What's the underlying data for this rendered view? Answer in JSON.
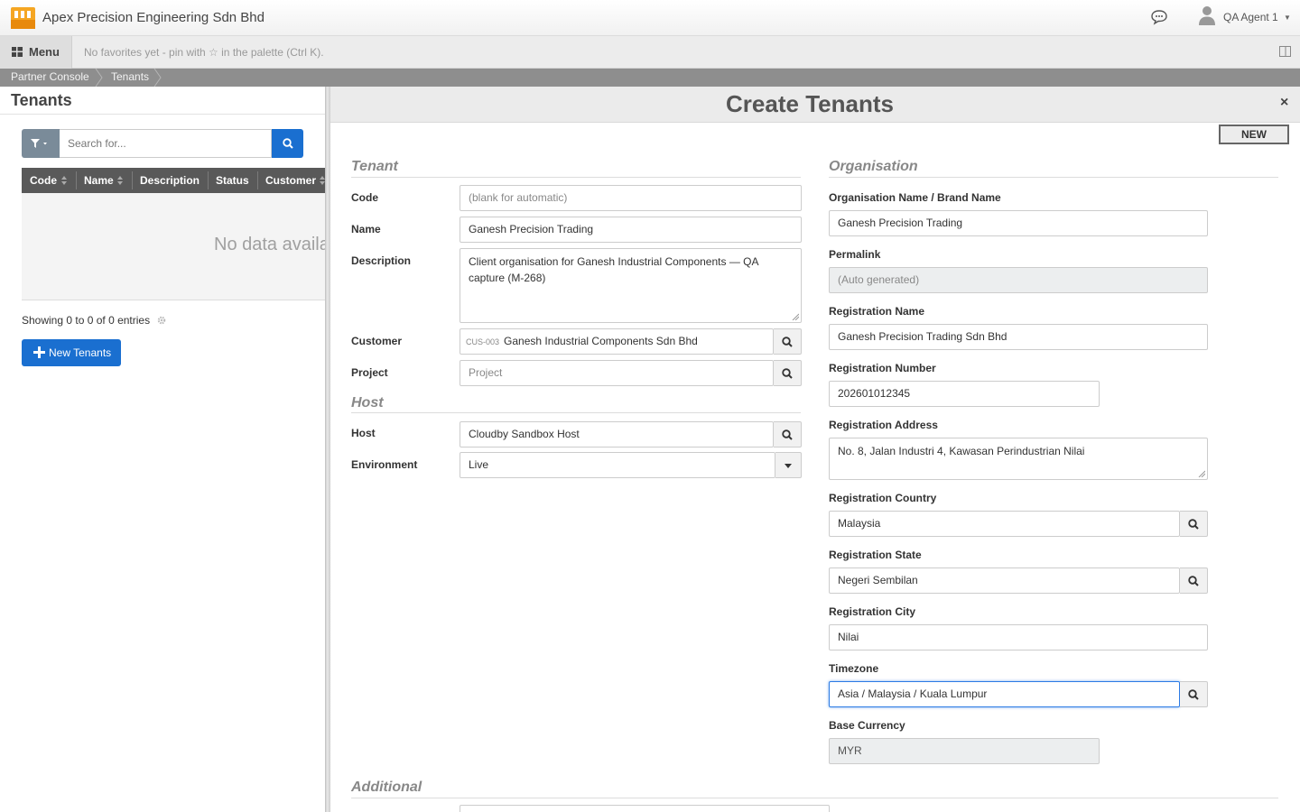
{
  "app": {
    "title": "Apex Precision Engineering Sdn Bhd",
    "user_name": "QA Agent 1",
    "accent": "#1a6fd0"
  },
  "menubar": {
    "menu_label": "Menu",
    "favorites_hint": "No favorites yet - pin with ☆ in the palette (Ctrl K)."
  },
  "breadcrumb": [
    "Partner Console",
    "Tenants"
  ],
  "list": {
    "title": "Tenants",
    "search_placeholder": "Search for...",
    "columns": [
      "Code",
      "Name",
      "Description",
      "Status",
      "Customer"
    ],
    "rows": [],
    "empty_text": "No data available in table",
    "showing": "Showing 0 to 0 of 0 entries",
    "new_button": "New Tenants"
  },
  "modal": {
    "title": "Create Tenants",
    "close": "×",
    "status_badge": "NEW",
    "sections": {
      "tenant": "Tenant",
      "organisation": "Organisation",
      "host": "Host",
      "additional": "Additional"
    },
    "tenant": {
      "code_label": "Code",
      "code_placeholder": "(blank for automatic)",
      "name_label": "Name",
      "name_value": "Ganesh Precision Trading",
      "description_label": "Description",
      "description_value": "Client organisation for Ganesh Industrial Components — QA capture (M-268)",
      "customer_label": "Customer",
      "customer_code": "CUS-003",
      "customer_value": "Ganesh Industrial Components Sdn Bhd",
      "project_label": "Project",
      "project_placeholder": "Project"
    },
    "host": {
      "host_label": "Host",
      "host_value": "Cloudby Sandbox Host",
      "environment_label": "Environment",
      "environment_value": "Live"
    },
    "organisation": {
      "org_name_label": "Organisation Name / Brand Name",
      "org_name_value": "Ganesh Precision Trading",
      "permalink_label": "Permalink",
      "permalink_placeholder": "(Auto generated)",
      "reg_name_label": "Registration Name",
      "reg_name_value": "Ganesh Precision Trading Sdn Bhd",
      "reg_number_label": "Registration Number",
      "reg_number_value": "202601012345",
      "reg_address_label": "Registration Address",
      "reg_address_value": "No. 8, Jalan Industri 4, Kawasan Perindustrian Nilai",
      "reg_country_label": "Registration Country",
      "reg_country_value": "Malaysia",
      "reg_state_label": "Registration State",
      "reg_state_value": "Negeri Sembilan",
      "reg_city_label": "Registration City",
      "reg_city_value": "Nilai",
      "timezone_label": "Timezone",
      "timezone_value": "Asia / Malaysia / Kuala Lumpur",
      "currency_label": "Base Currency",
      "currency_value": "MYR"
    }
  }
}
